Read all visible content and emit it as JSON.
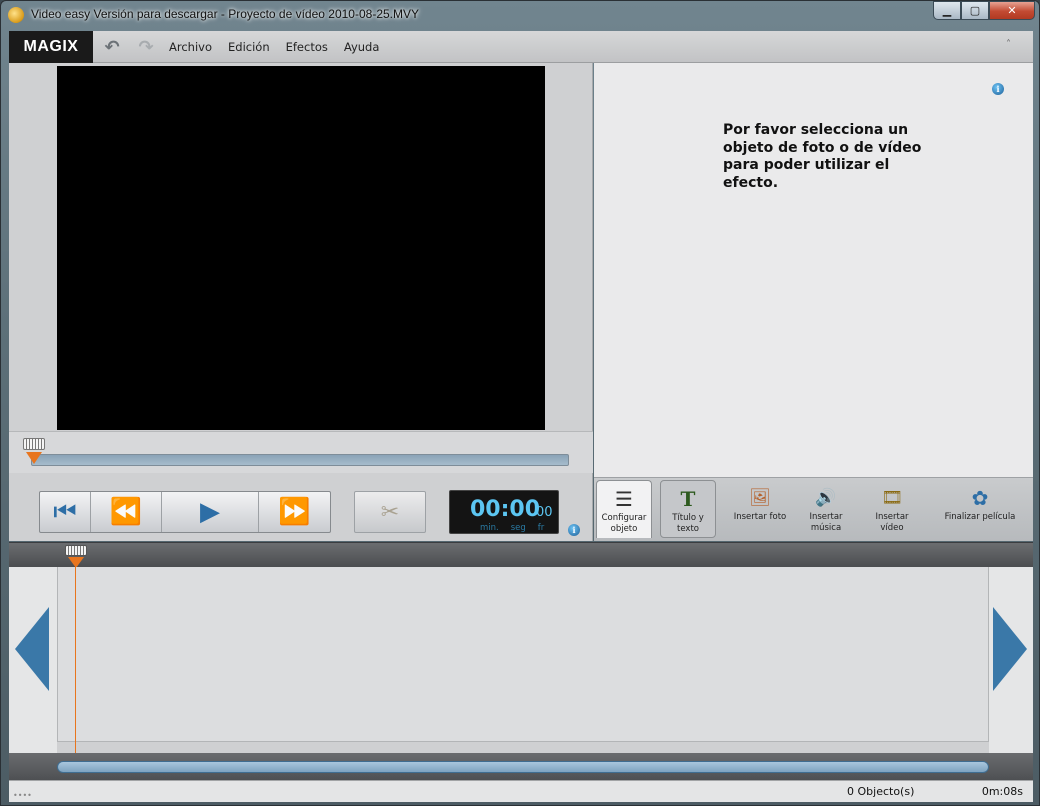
{
  "window": {
    "title": "Video easy Versión para descargar - Proyecto de vídeo 2010-08-25.MVY",
    "minimize": "▁",
    "maximize": "▢",
    "close": "✕"
  },
  "menubar": {
    "logo": "MAGIX",
    "undo_icon": "↶",
    "redo_icon": "↷",
    "items": [
      "Archivo",
      "Edición",
      "Efectos",
      "Ayuda"
    ],
    "collapse_icon": "˄"
  },
  "transport": {
    "to_start": "⏮",
    "rewind": "⏪",
    "play": "▶",
    "forward": "⏩",
    "cut_icon": "✂"
  },
  "timecode": {
    "main": "00:00",
    "frames": "00",
    "labels": [
      "min.",
      "seg",
      "fr"
    ]
  },
  "info_icon": "i",
  "effects_panel": {
    "message": "Por favor selecciona un objeto de foto o de vídeo para poder utilizar el efecto."
  },
  "tabs": [
    {
      "label": "Configurar objeto",
      "icon": "sliders-icon",
      "glyph": "☰"
    },
    {
      "label": "Título y texto",
      "icon": "title-text-icon",
      "glyph": "T"
    },
    {
      "label": "Insertar foto",
      "icon": "insert-photo-icon",
      "glyph": "🖼"
    },
    {
      "label": "Insertar música",
      "icon": "insert-music-icon",
      "glyph": "🔊"
    },
    {
      "label": "Insertar vídeo",
      "icon": "insert-video-icon",
      "glyph": "🎞"
    },
    {
      "label": "Finalizar película",
      "icon": "finish-movie-icon",
      "glyph": "✿"
    }
  ],
  "statusbar": {
    "objects": "0 Objecto(s)",
    "duration": "0m:08s"
  },
  "colors": {
    "accent_blue": "#2d6ea6",
    "playhead_orange": "#e8751e",
    "timecode_cyan": "#5cc6f2"
  }
}
